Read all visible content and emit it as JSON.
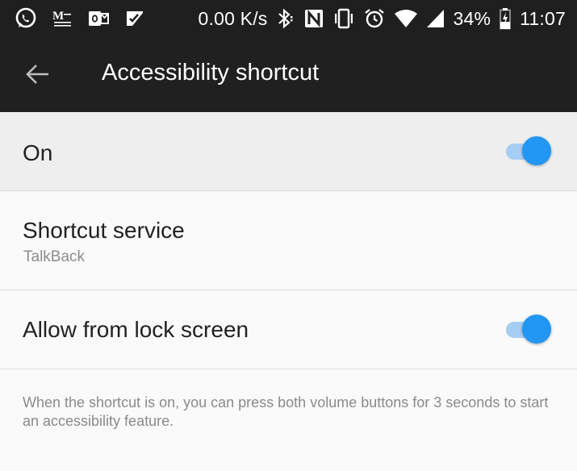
{
  "status_bar": {
    "network_speed": "0.00 K/s",
    "battery_percent": "34%",
    "time": "11:07",
    "left_icons": [
      "whatsapp-icon",
      "gmail-icon",
      "outlook-icon",
      "checkmark-app-icon"
    ],
    "right_icons": [
      "bluetooth-icon",
      "nfc-icon",
      "vibrate-icon",
      "alarm-icon",
      "wifi-icon",
      "cell-signal-icon",
      "battery-icon"
    ]
  },
  "app_bar": {
    "title": "Accessibility shortcut",
    "back_icon": "arrow-left-icon"
  },
  "settings": {
    "main_toggle": {
      "label": "On",
      "enabled": true
    },
    "shortcut_service": {
      "label": "Shortcut service",
      "value": "TalkBack"
    },
    "lock_screen": {
      "label": "Allow from lock screen",
      "enabled": true
    }
  },
  "footer": {
    "note": "When the shortcut is on, you can press both volume buttons for 3 seconds to start an accessibility feature."
  },
  "colors": {
    "app_bar_bg": "#202020",
    "accent": "#2196f3",
    "toggle_track": "#a6cdf3"
  }
}
